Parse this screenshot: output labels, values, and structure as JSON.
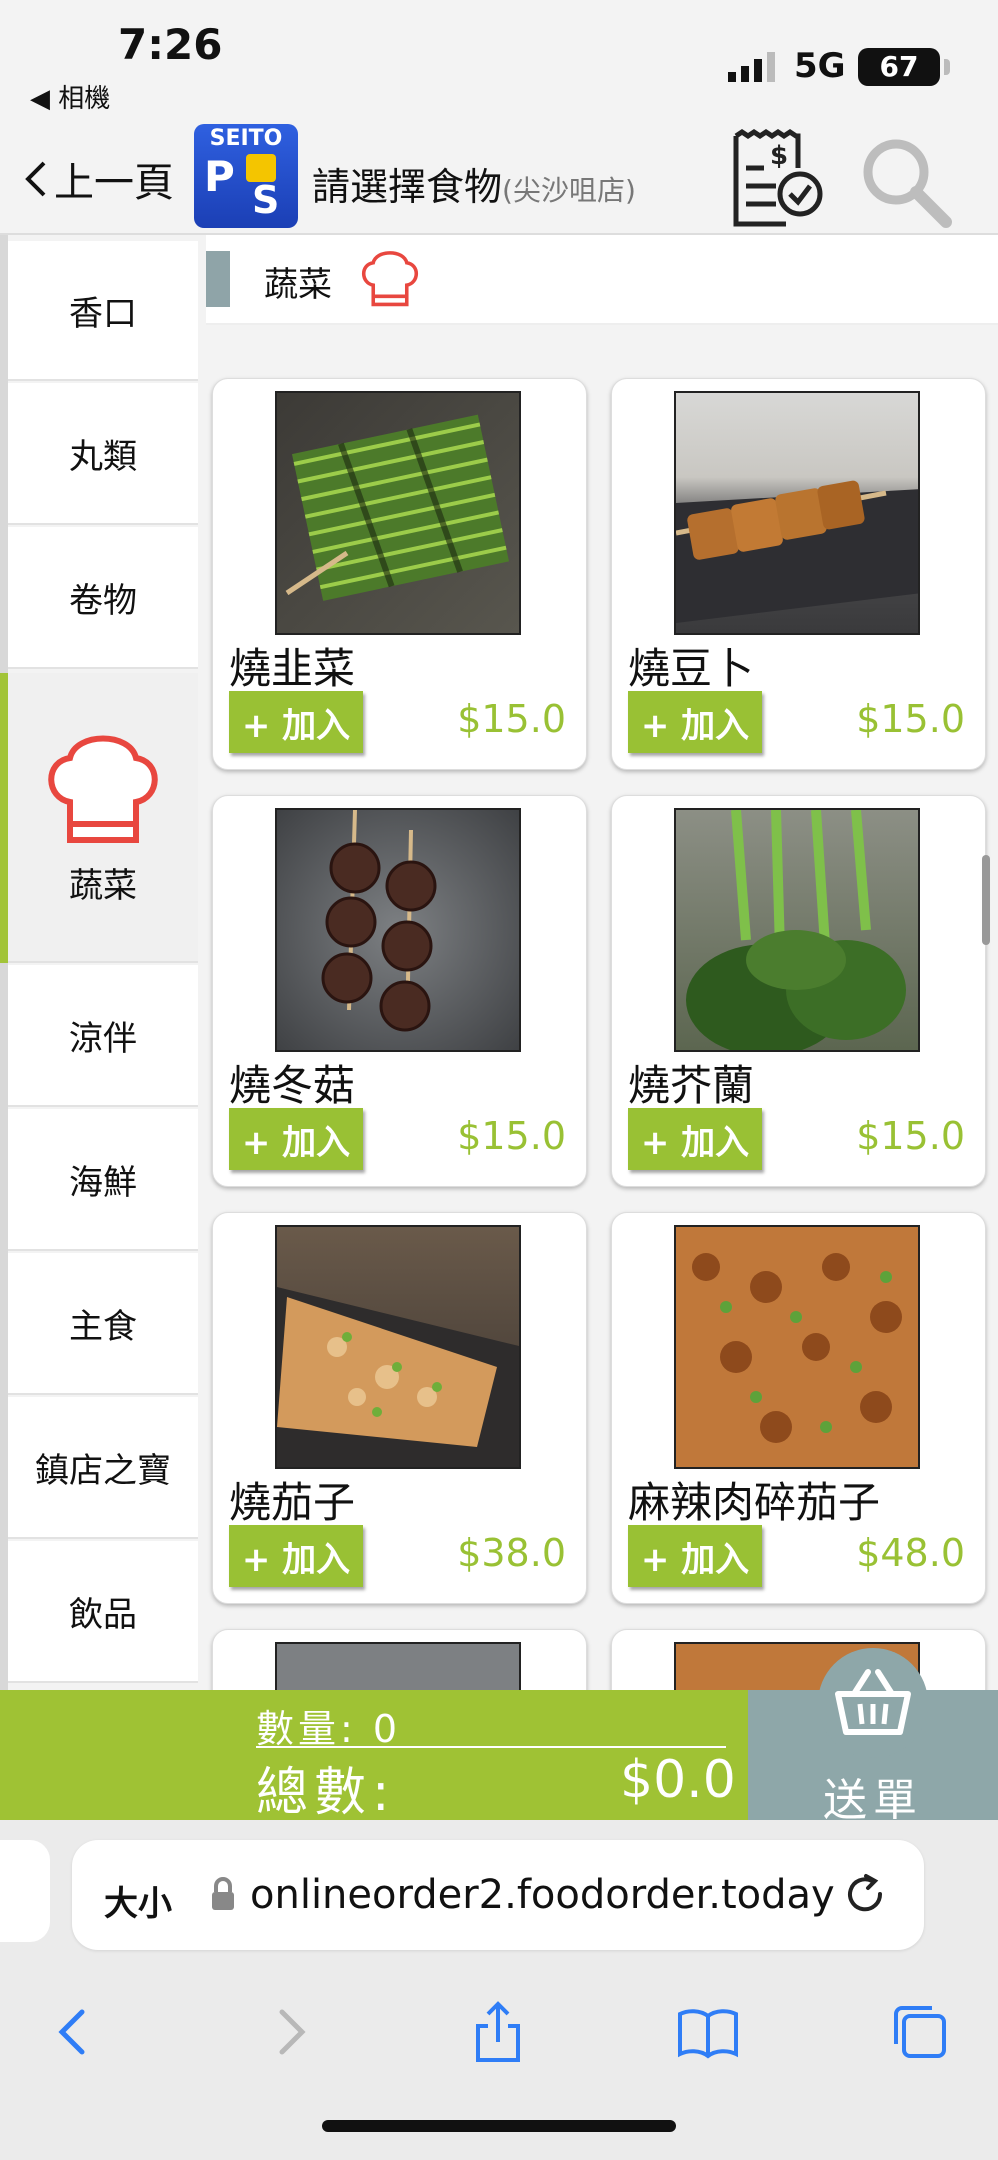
{
  "status_bar": {
    "time": "7:26",
    "back_app": "◀ 相機",
    "network": "5G",
    "battery": "67"
  },
  "header": {
    "back_label": "上一頁",
    "logo_text": "SEITO",
    "logo_p": "P",
    "logo_s": "S",
    "title": "請選擇食物",
    "store": "(尖沙咀店)"
  },
  "sidebar": {
    "items": [
      {
        "label": "香口"
      },
      {
        "label": "丸類"
      },
      {
        "label": "卷物"
      },
      {
        "label": "蔬菜",
        "active": true
      },
      {
        "label": "涼伴"
      },
      {
        "label": "海鮮"
      },
      {
        "label": "主食"
      },
      {
        "label": "鎮店之寶"
      },
      {
        "label": "飲品"
      }
    ]
  },
  "section": {
    "label": "蔬菜"
  },
  "add_label": "+ 加入",
  "items": [
    {
      "name": "燒韭菜",
      "price": "$15.0"
    },
    {
      "name": "燒豆卜",
      "price": "$15.0"
    },
    {
      "name": "燒冬菇",
      "price": "$15.0"
    },
    {
      "name": "燒芥蘭",
      "price": "$15.0"
    },
    {
      "name": "燒茄子",
      "price": "$38.0"
    },
    {
      "name": "麻辣肉碎茄子",
      "price": "$48.0"
    }
  ],
  "cart": {
    "qty_label": "數量:",
    "qty_value": "0",
    "total_label": "總數:",
    "total_value": "$0.0",
    "send_label": "送單"
  },
  "browser": {
    "size_label": "大小",
    "url": "onlineorder2.foodorder.today"
  },
  "colors": {
    "accent": "#99c134",
    "send": "#8ea7a9",
    "chef": "#e8473f"
  }
}
